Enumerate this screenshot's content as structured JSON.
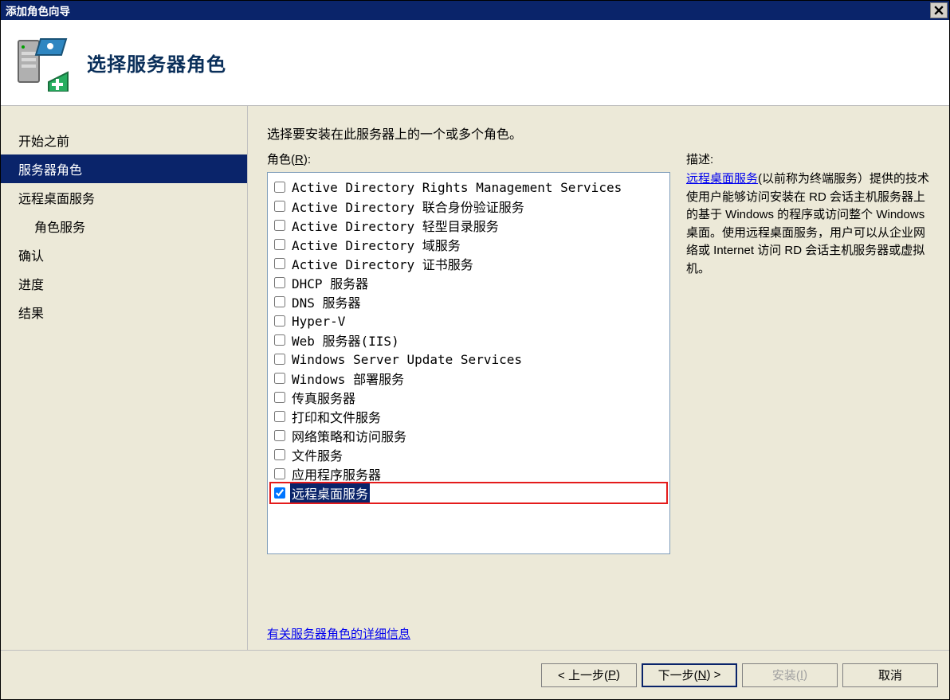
{
  "window": {
    "title": "添加角色向导"
  },
  "header": {
    "title": "选择服务器角色"
  },
  "sidebar": {
    "items": [
      {
        "label": "开始之前",
        "selected": false,
        "child": false
      },
      {
        "label": "服务器角色",
        "selected": true,
        "child": false
      },
      {
        "label": "远程桌面服务",
        "selected": false,
        "child": false
      },
      {
        "label": "角色服务",
        "selected": false,
        "child": true
      },
      {
        "label": "确认",
        "selected": false,
        "child": false
      },
      {
        "label": "进度",
        "selected": false,
        "child": false
      },
      {
        "label": "结果",
        "selected": false,
        "child": false
      }
    ]
  },
  "main": {
    "instruction": "选择要安装在此服务器上的一个或多个角色。",
    "roles_label_prefix": "角色(",
    "roles_label_hotkey": "R",
    "roles_label_suffix": "):",
    "roles": [
      {
        "label": "Active Directory Rights Management Services",
        "checked": false,
        "selected": false
      },
      {
        "label": "Active Directory 联合身份验证服务",
        "checked": false,
        "selected": false
      },
      {
        "label": "Active Directory 轻型目录服务",
        "checked": false,
        "selected": false
      },
      {
        "label": "Active Directory 域服务",
        "checked": false,
        "selected": false
      },
      {
        "label": "Active Directory 证书服务",
        "checked": false,
        "selected": false
      },
      {
        "label": "DHCP 服务器",
        "checked": false,
        "selected": false
      },
      {
        "label": "DNS 服务器",
        "checked": false,
        "selected": false
      },
      {
        "label": "Hyper-V",
        "checked": false,
        "selected": false
      },
      {
        "label": "Web 服务器(IIS)",
        "checked": false,
        "selected": false
      },
      {
        "label": "Windows Server Update Services",
        "checked": false,
        "selected": false
      },
      {
        "label": "Windows 部署服务",
        "checked": false,
        "selected": false
      },
      {
        "label": "传真服务器",
        "checked": false,
        "selected": false
      },
      {
        "label": "打印和文件服务",
        "checked": false,
        "selected": false
      },
      {
        "label": "网络策略和访问服务",
        "checked": false,
        "selected": false
      },
      {
        "label": "文件服务",
        "checked": false,
        "selected": false
      },
      {
        "label": "应用程序服务器",
        "checked": false,
        "selected": false
      },
      {
        "label": "远程桌面服务",
        "checked": true,
        "selected": true,
        "highlighted": true
      }
    ],
    "description_heading": "描述:",
    "description_link": "远程桌面服务",
    "description_body": "(以前称为终端服务）提供的技术使用户能够访问安装在 RD 会话主机服务器上的基于 Windows 的程序或访问整个 Windows 桌面。使用远程桌面服务，用户可以从企业网络或 Internet 访问 RD 会话主机服务器或虚拟机。",
    "more_info_link": "有关服务器角色的详细信息"
  },
  "footer": {
    "back_prefix": "< 上一步(",
    "back_hotkey": "P",
    "back_suffix": ")",
    "next_prefix": "下一步(",
    "next_hotkey": "N",
    "next_suffix": ") >",
    "install_prefix": "安装(",
    "install_hotkey": "I",
    "install_suffix": ")",
    "cancel": "取消"
  }
}
